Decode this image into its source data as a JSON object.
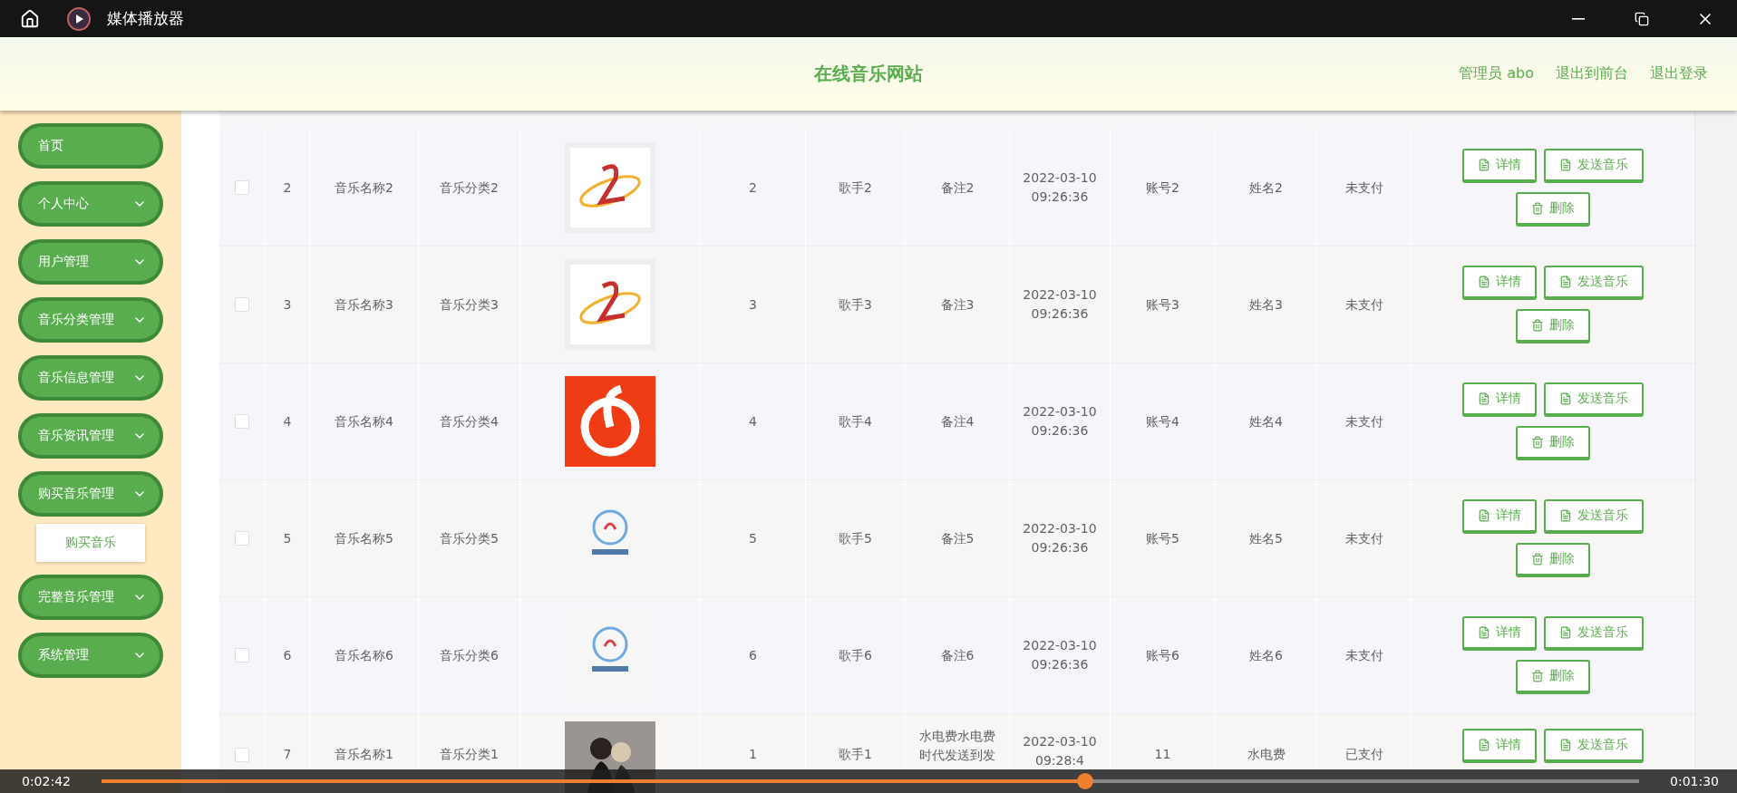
{
  "window": {
    "title": "媒体播放器"
  },
  "header": {
    "site_title": "在线音乐网站",
    "user": "管理员 abo",
    "links": [
      "退出到前台",
      "退出登录"
    ]
  },
  "sidebar": {
    "items": [
      {
        "label": "首页",
        "kind": "link"
      },
      {
        "label": "个人中心",
        "kind": "menu"
      },
      {
        "label": "用户管理",
        "kind": "menu"
      },
      {
        "label": "音乐分类管理",
        "kind": "menu"
      },
      {
        "label": "音乐信息管理",
        "kind": "menu"
      },
      {
        "label": "音乐资讯管理",
        "kind": "menu"
      },
      {
        "label": "购买音乐管理",
        "kind": "menu",
        "children": [
          {
            "label": "购买音乐",
            "selected": true
          }
        ]
      },
      {
        "label": "完整音乐管理",
        "kind": "menu"
      },
      {
        "label": "系统管理",
        "kind": "menu"
      }
    ]
  },
  "table": {
    "rows": [
      {
        "checked": false,
        "index": "2",
        "name": "音乐名称2",
        "category": "音乐分类2",
        "picture": {
          "kind": "picture"
        },
        "number": "2",
        "singer": "歌手2",
        "note": "备注2",
        "time": "2022-03-10 09:26:36",
        "account": "账号2",
        "person": "姓名2",
        "status": "未支付",
        "actions": [
          {
            "kind": "detail",
            "label": "详情"
          },
          {
            "kind": "send",
            "label": "发送音乐"
          },
          {
            "kind": "delete",
            "label": "删除"
          }
        ]
      },
      {
        "checked": false,
        "index": "3",
        "name": "音乐名称3",
        "category": "音乐分类3",
        "picture": {
          "kind": "picture"
        },
        "number": "3",
        "singer": "歌手3",
        "note": "备注3",
        "time": "2022-03-10 09:26:36",
        "account": "账号3",
        "person": "姓名3",
        "status": "未支付",
        "actions": [
          {
            "kind": "detail",
            "label": "详情"
          },
          {
            "kind": "send",
            "label": "发送音乐"
          },
          {
            "kind": "delete",
            "label": "删除"
          }
        ]
      },
      {
        "checked": false,
        "index": "4",
        "name": "音乐名称4",
        "category": "音乐分类4",
        "picture": {
          "kind": "picture"
        },
        "number": "4",
        "singer": "歌手4",
        "note": "备注4",
        "time": "2022-03-10 09:26:36",
        "account": "账号4",
        "person": "姓名4",
        "status": "未支付",
        "actions": [
          {
            "kind": "detail",
            "label": "详情"
          },
          {
            "kind": "send",
            "label": "发送音乐"
          },
          {
            "kind": "delete",
            "label": "删除"
          }
        ]
      },
      {
        "checked": false,
        "index": "5",
        "name": "音乐名称5",
        "category": "音乐分类5",
        "picture": {
          "kind": "picture"
        },
        "number": "5",
        "singer": "歌手5",
        "note": "备注5",
        "time": "2022-03-10 09:26:36",
        "account": "账号5",
        "person": "姓名5",
        "status": "未支付",
        "actions": [
          {
            "kind": "detail",
            "label": "详情"
          },
          {
            "kind": "send",
            "label": "发送音乐"
          },
          {
            "kind": "delete",
            "label": "删除"
          }
        ]
      },
      {
        "checked": false,
        "index": "6",
        "name": "音乐名称6",
        "category": "音乐分类6",
        "picture": {
          "kind": "picture"
        },
        "number": "6",
        "singer": "歌手6",
        "note": "备注6",
        "time": "2022-03-10 09:26:36",
        "account": "账号6",
        "person": "姓名6",
        "status": "未支付",
        "actions": [
          {
            "kind": "detail",
            "label": "详情"
          },
          {
            "kind": "send",
            "label": "发送音乐"
          },
          {
            "kind": "delete",
            "label": "删除"
          }
        ]
      },
      {
        "checked": false,
        "index": "7",
        "name": "音乐名称1",
        "category": "音乐分类1",
        "picture": {
          "kind": "picture"
        },
        "number": "1",
        "singer": "歌手1",
        "note": "水电费水电费时代发送到发",
        "time": "2022-03-10 09:28:4",
        "account": "11",
        "person": "水电费",
        "status": "已支付",
        "actions": [
          {
            "kind": "detail",
            "label": "详情"
          },
          {
            "kind": "send",
            "label": "发送音乐"
          }
        ]
      }
    ]
  },
  "player": {
    "elapsed": "0:02:42",
    "remaining": "0:01:30",
    "level": 0.64
  }
}
